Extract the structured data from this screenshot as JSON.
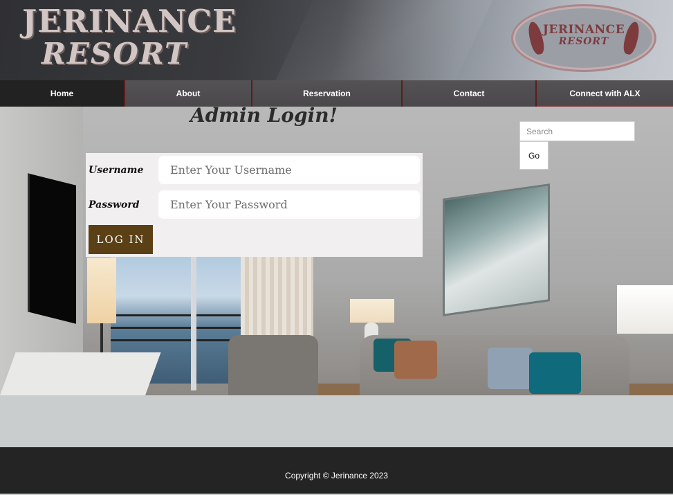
{
  "header": {
    "logo_line1": "JERINANCE",
    "logo_line2": "RESORT",
    "badge_line1": "JERINANCE",
    "badge_line2": "RESORT"
  },
  "nav": {
    "items": [
      {
        "label": "Home",
        "active": true
      },
      {
        "label": "About",
        "active": false
      },
      {
        "label": "Reservation",
        "active": false
      },
      {
        "label": "Contact",
        "active": false
      },
      {
        "label": "Connect with ALX",
        "active": false
      }
    ]
  },
  "login": {
    "title": "Admin Login!",
    "username_label": "Username",
    "username_placeholder": "Enter Your Username",
    "password_label": "Password",
    "password_placeholder": "Enter Your Password",
    "submit_label": "LOG IN"
  },
  "search": {
    "placeholder": "Search",
    "button_label": "Go"
  },
  "footer": {
    "copyright": "Copyright © Jerinance 2023"
  },
  "colors": {
    "nav_bg": "#4e4c4e",
    "nav_active_bg": "#222222",
    "login_button": "#5b4016",
    "footer_bg": "#242424",
    "page_bg": "#c9cdcd"
  }
}
